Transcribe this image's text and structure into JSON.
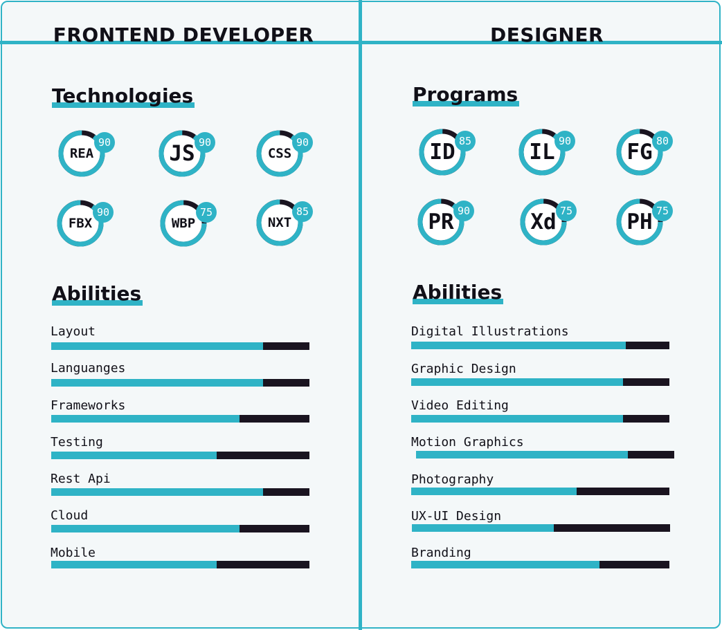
{
  "accent_color": "#2fb3c6",
  "dark_color": "#1a1420",
  "columns": [
    {
      "title": "FRONTEND DEVELOPER",
      "tools_title": "Technologies",
      "tools": [
        {
          "code": "REA",
          "score": "90",
          "value": 90
        },
        {
          "code": "JS",
          "score": "90",
          "value": 90
        },
        {
          "code": "CSS",
          "score": "90",
          "value": 90
        },
        {
          "code": "FBX",
          "score": "90",
          "value": 90
        },
        {
          "code": "WBP",
          "score": "75",
          "value": 75
        },
        {
          "code": "NXT",
          "score": "85",
          "value": 85
        }
      ],
      "abilities_title": "Abilities",
      "abilities": [
        {
          "label": "Layout",
          "level": 82
        },
        {
          "label": "Languanges",
          "level": 82
        },
        {
          "label": "Frameworks",
          "level": 73
        },
        {
          "label": "Testing",
          "level": 64
        },
        {
          "label": "Rest Api",
          "level": 82
        },
        {
          "label": "Cloud",
          "level": 73
        },
        {
          "label": "Mobile",
          "level": 64
        }
      ]
    },
    {
      "title": "DESIGNER",
      "tools_title": "Programs",
      "tools": [
        {
          "code": "ID",
          "score": "85",
          "value": 85
        },
        {
          "code": "IL",
          "score": "90",
          "value": 90
        },
        {
          "code": "FG",
          "score": "80",
          "value": 80
        },
        {
          "code": "PR",
          "score": "90",
          "value": 90
        },
        {
          "code": "Xd",
          "score": "75",
          "value": 75
        },
        {
          "code": "PH",
          "score": "75",
          "value": 75
        }
      ],
      "abilities_title": "Abilities",
      "abilities": [
        {
          "label": "Digital Illustrations",
          "level": 83
        },
        {
          "label": "Graphic Design",
          "level": 82
        },
        {
          "label": "Video Editing",
          "level": 82
        },
        {
          "label": "Motion Graphics",
          "level": 82
        },
        {
          "label": "Photography",
          "level": 64
        },
        {
          "label": "UX-UI Design",
          "level": 55
        },
        {
          "label": "Branding",
          "level": 73
        }
      ]
    }
  ]
}
